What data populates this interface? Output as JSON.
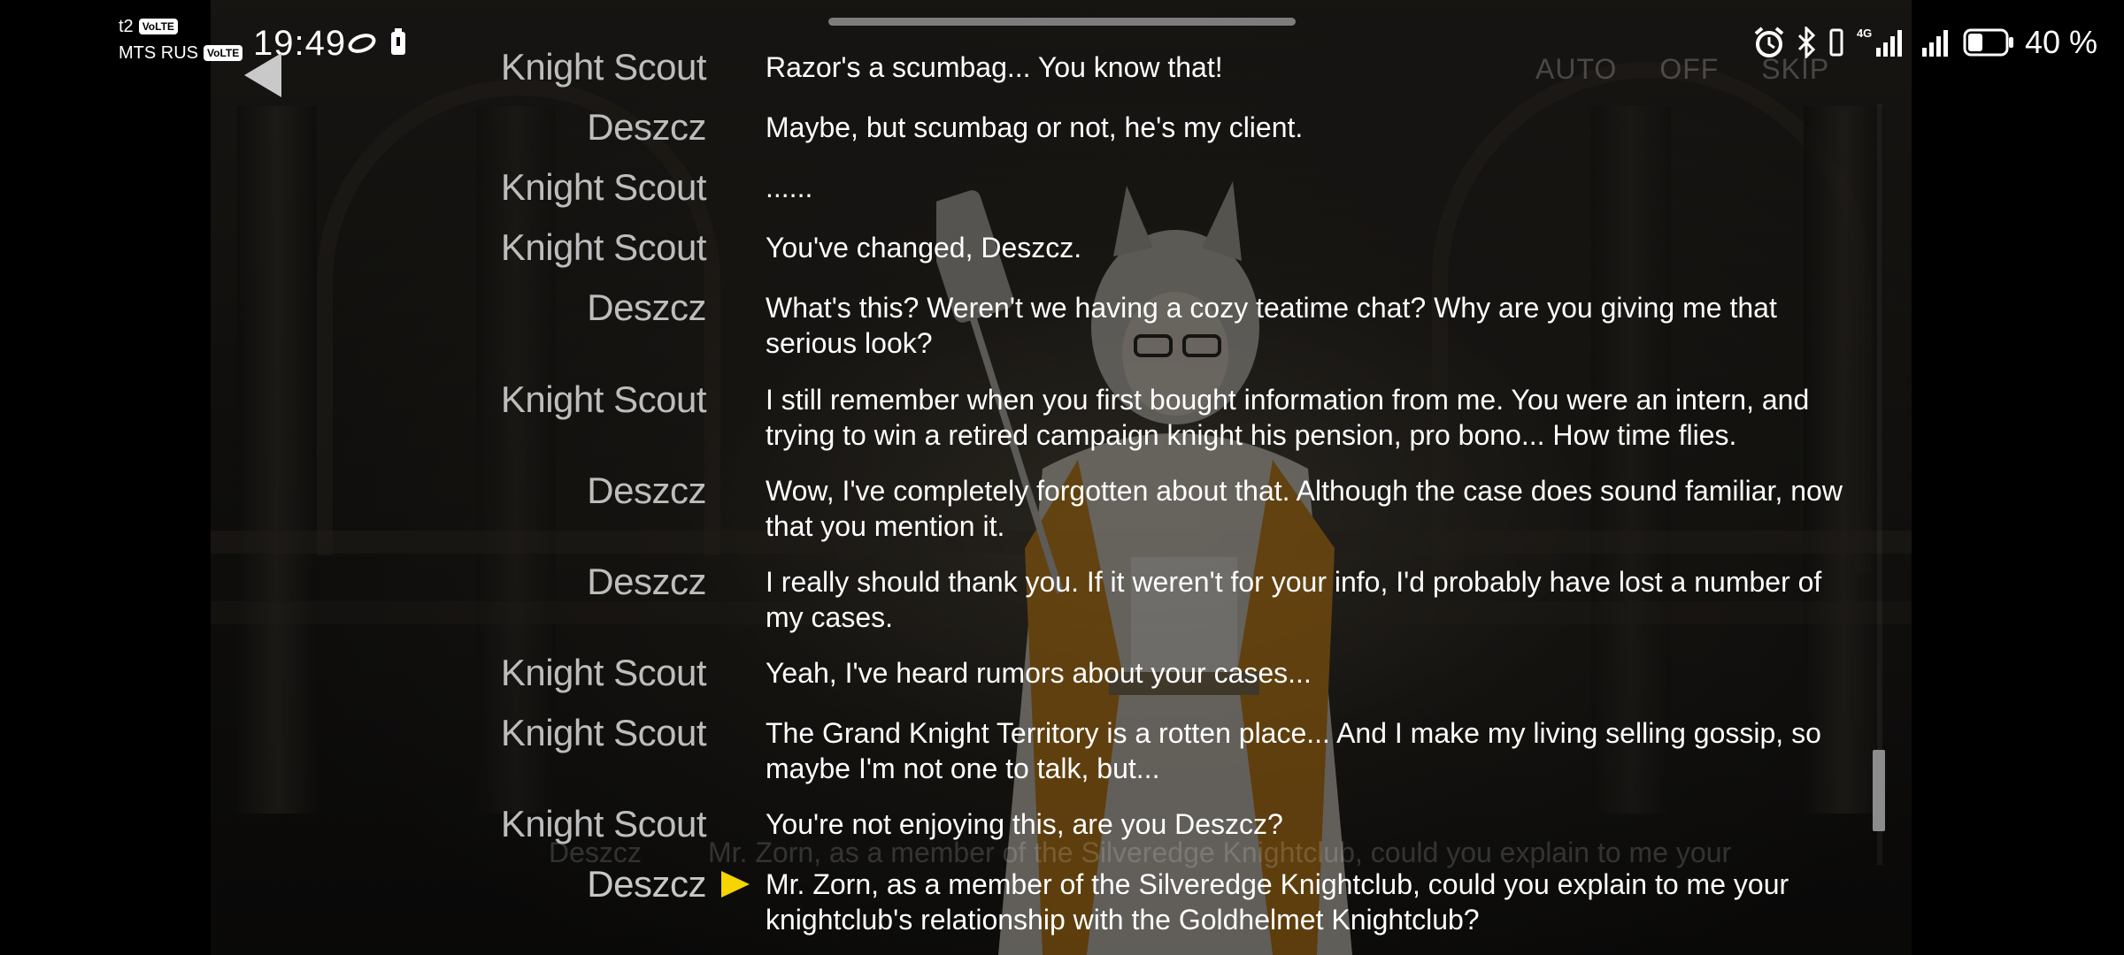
{
  "status_bar": {
    "carrier_1": "t2",
    "carrier_1_badge": "VoLTE",
    "carrier_2": "MTS RUS",
    "carrier_2_badge": "VoLTE",
    "time": "19:49",
    "network": "4G",
    "battery": "40 %",
    "battery_level": 0.4
  },
  "controls": {
    "auto_label": "AUTO",
    "off_label": "OFF",
    "skip_label": "SKIP"
  },
  "dialogue": [
    {
      "speaker": "Knight Scout",
      "text": "Razor's a scumbag... You know that!"
    },
    {
      "speaker": "Deszcz",
      "text": "Maybe, but scumbag or not, he's my client."
    },
    {
      "speaker": "Knight Scout",
      "text": "......"
    },
    {
      "speaker": "Knight Scout",
      "text": "You've changed, Deszcz."
    },
    {
      "speaker": "Deszcz",
      "text": "What's this? Weren't we having a cozy teatime chat? Why are you giving me that serious look?"
    },
    {
      "speaker": "Knight Scout",
      "text": "I still remember when you first bought information from me. You were an intern, and trying to win a retired campaign knight his pension, pro bono... How time flies."
    },
    {
      "speaker": "Deszcz",
      "text": "Wow, I've completely forgotten about that. Although the case does sound familiar, now that you mention it."
    },
    {
      "speaker": "Deszcz",
      "text": "I really should thank you. If it weren't for your info, I'd probably have lost a number of my cases."
    },
    {
      "speaker": "Knight Scout",
      "text": "Yeah, I've heard rumors about your cases..."
    },
    {
      "speaker": "Knight Scout",
      "text": "The Grand Knight Territory is a rotten place... And I make my living selling gossip, so maybe I'm not one to talk, but..."
    },
    {
      "speaker": "Knight Scout",
      "text": "You're not enjoying this, are you Deszcz?"
    },
    {
      "speaker": "Deszcz",
      "text": "Mr. Zorn, as a member of the Silveredge Knightclub, could you explain to me your knightclub's relationship with the Goldhelmet Knightclub?"
    }
  ],
  "ghost": {
    "speaker": "Deszcz",
    "text": "Mr. Zorn, as a member of the Silveredge Knightclub, could you explain to me your"
  },
  "scroll_position": 0.95
}
